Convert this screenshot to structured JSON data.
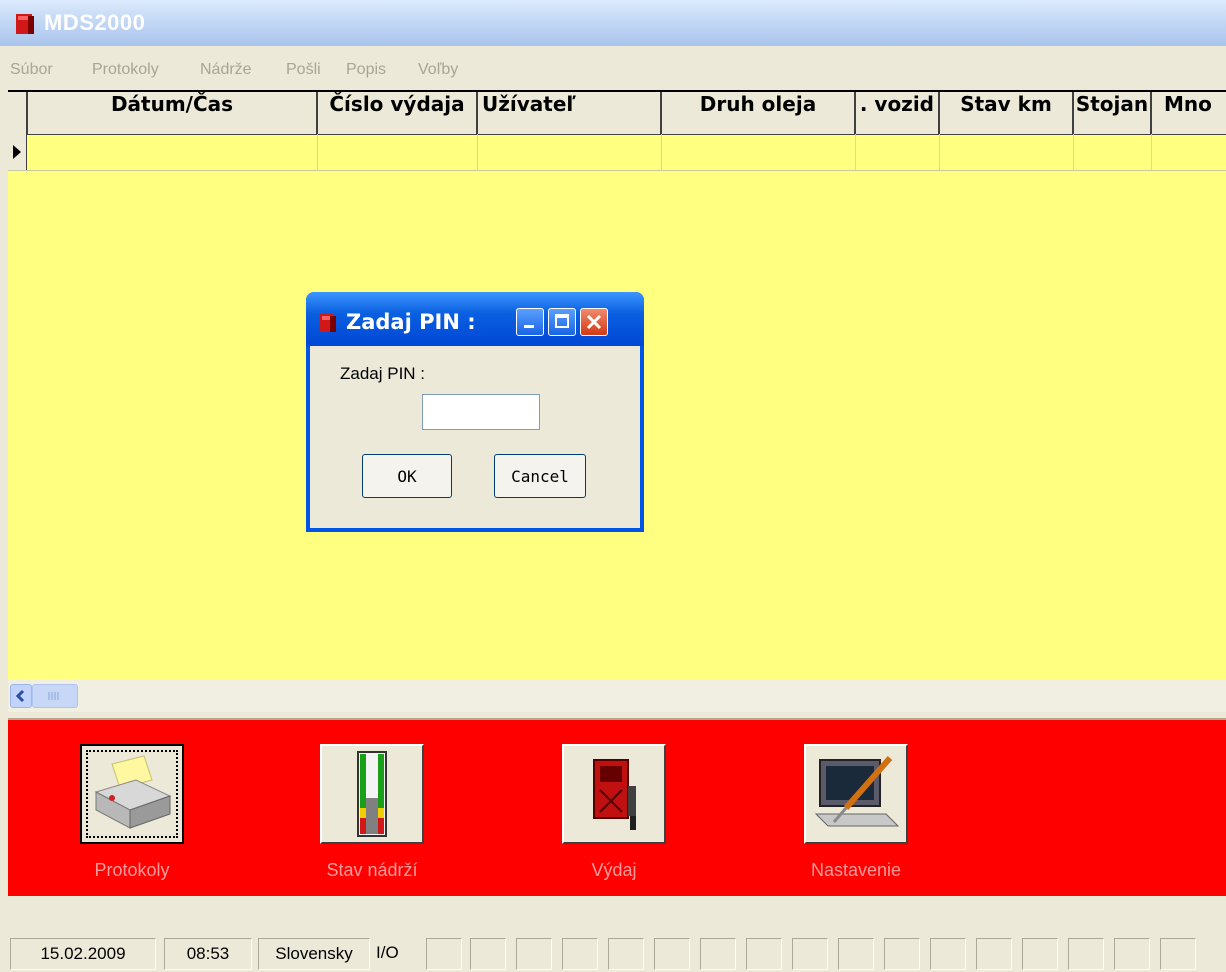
{
  "window": {
    "title": "MDS2000"
  },
  "menu": [
    "Súbor",
    "Protokoly",
    "Nádrže",
    "Pošli",
    "Popis",
    "Voľby"
  ],
  "grid": {
    "columns": [
      "Dátum/Čas",
      "Číslo výdaja",
      "Užívateľ",
      "Druh oleja",
      ". vozid",
      "Stav km",
      "Stojan",
      "Mno"
    ]
  },
  "toolbar": {
    "buttons": [
      {
        "label": "Protokoly",
        "icon": "printer-icon"
      },
      {
        "label": "Stav nádrží",
        "icon": "tank-level-icon"
      },
      {
        "label": "Výdaj",
        "icon": "fuel-pump-icon"
      },
      {
        "label": "Nastavenie",
        "icon": "computer-settings-icon"
      }
    ]
  },
  "status": {
    "date": "15.02.2009",
    "time": "08:53",
    "language": "Slovensky",
    "io": "I/O"
  },
  "dialog": {
    "title": "Zadaj PIN :",
    "label": "Zadaj PIN :",
    "pin_value": "",
    "ok_label": "OK",
    "cancel_label": "Cancel"
  },
  "colors": {
    "grid_background": "#ffff80",
    "toolbar_background": "#ff0000",
    "dialog_title": "#0055e6"
  }
}
